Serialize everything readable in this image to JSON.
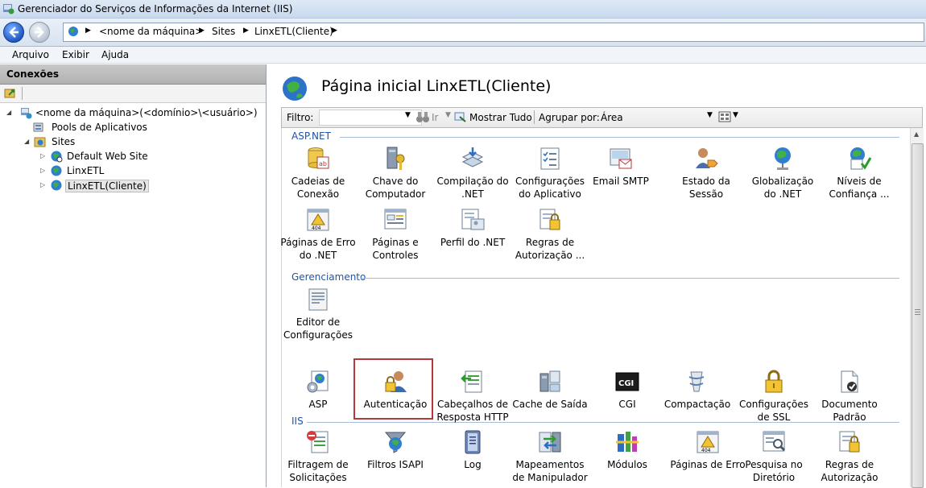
{
  "window": {
    "title": "Gerenciador do Serviços de Informações da Internet (IIS)"
  },
  "address": {
    "crumbs": [
      "<nome da máquina>",
      "Sites",
      "LinxETL(Cliente)"
    ]
  },
  "menu": {
    "arquivo": "Arquivo",
    "exibir": "Exibir",
    "ajuda": "Ajuda"
  },
  "connections": {
    "title": "Conexões",
    "tree": [
      "<nome da máquina>(<domínio>\\<usuário>)",
      "Pools de Aplicativos",
      "Sites",
      "Default Web Site",
      "LinxETL",
      "LinxETL(Cliente)"
    ]
  },
  "page": {
    "title": "Página inicial LinxETL(Cliente)"
  },
  "filter": {
    "label": "Filtro:",
    "ir": "Ir",
    "show_all": "Mostrar Tudo",
    "group_by": "Agrupar por:",
    "group_value": "Área"
  },
  "sections": {
    "aspnet": {
      "title": "ASP.NET",
      "items": [
        "Cadeias de Conexão",
        "Chave do Computador",
        "Compilação do .NET",
        "Configurações do Aplicativo",
        "Email SMTP",
        "Estado da Sessão",
        "Globalização do .NET",
        "Níveis de Confiança ...",
        "Páginas de Erro do .NET",
        "Páginas e Controles",
        "Perfil do .NET",
        "Regras de Autorização ..."
      ]
    },
    "gerenciamento": {
      "title": "Gerenciamento",
      "items": [
        "Editor de Configurações"
      ]
    },
    "iis": {
      "title": "IIS",
      "items": [
        "ASP",
        "Autenticação",
        "Cabeçalhos de Resposta HTTP",
        "Cache de Saída",
        "CGI",
        "Compactação",
        "Configurações de SSL",
        "Documento Padrão",
        "Filtragem de Solicitações",
        "Filtros ISAPI",
        "Log",
        "Mapeamentos de Manipulador",
        "Módulos",
        "Páginas de Erro",
        "Pesquisa no Diretório",
        "Regras de Autorização"
      ]
    }
  },
  "colors": {
    "accent": "#1f53a3",
    "highlight": "#b23a3a"
  }
}
